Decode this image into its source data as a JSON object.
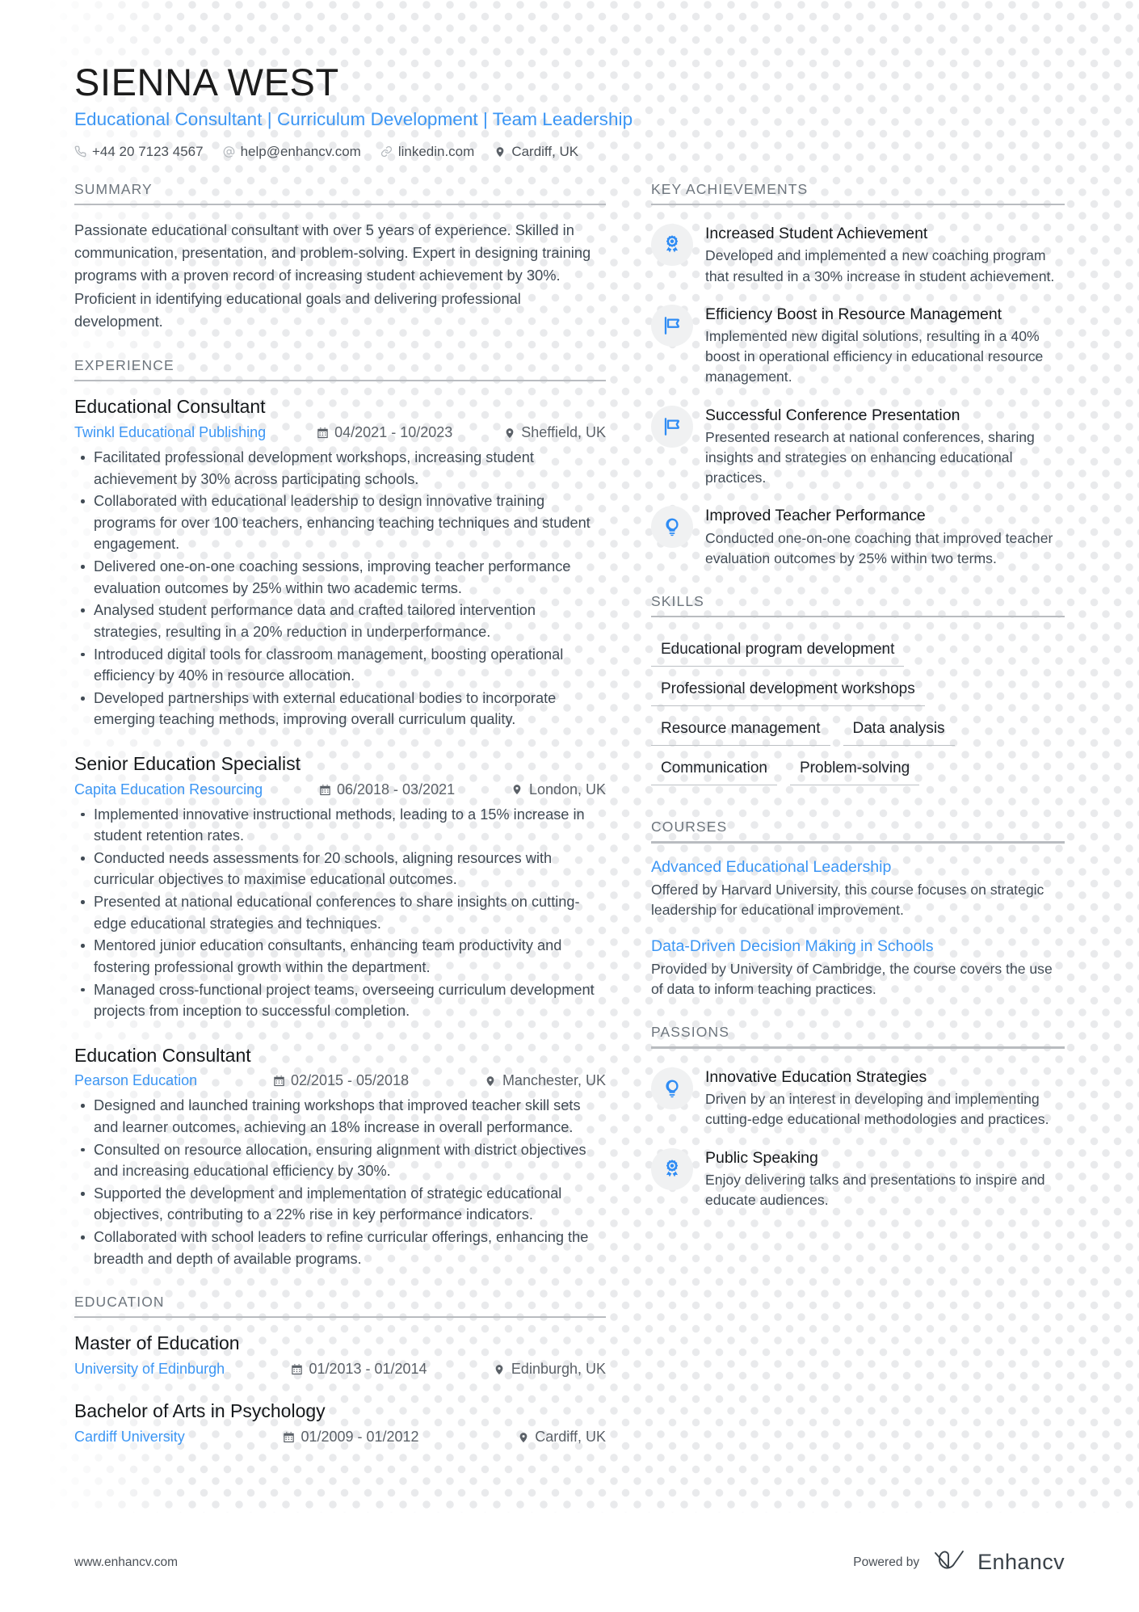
{
  "header": {
    "name": "SIENNA WEST",
    "headline": "Educational Consultant | Curriculum Development | Team Leadership",
    "contacts": [
      {
        "icon": "phone-icon",
        "value": "+44 20 7123 4567"
      },
      {
        "icon": "email-icon",
        "value": "help@enhancv.com"
      },
      {
        "icon": "link-icon",
        "value": "linkedin.com"
      },
      {
        "icon": "location-pin-icon",
        "value": "Cardiff, UK"
      }
    ]
  },
  "summary": {
    "title": "SUMMARY",
    "text": "Passionate educational consultant with over 5 years of experience. Skilled in communication, presentation, and problem-solving. Expert in designing training programs with a proven record of increasing student achievement by 30%. Proficient in identifying educational goals and delivering professional development."
  },
  "experience": {
    "title": "EXPERIENCE",
    "entries": [
      {
        "role": "Educational Consultant",
        "company": "Twinkl Educational Publishing",
        "dates": "04/2021 - 10/2023",
        "location": "Sheffield, UK",
        "bullets": [
          "Facilitated professional development workshops, increasing student achievement by 30% across participating schools.",
          "Collaborated with educational leadership to design innovative training programs for over 100 teachers, enhancing teaching techniques and student engagement.",
          "Delivered one-on-one coaching sessions, improving teacher performance evaluation outcomes by 25% within two academic terms.",
          "Analysed student performance data and crafted tailored intervention strategies, resulting in a 20% reduction in underperformance.",
          "Introduced digital tools for classroom management, boosting operational efficiency by 40% in resource allocation.",
          "Developed partnerships with external educational bodies to incorporate emerging teaching methods, improving overall curriculum quality."
        ]
      },
      {
        "role": "Senior Education Specialist",
        "company": "Capita Education Resourcing",
        "dates": "06/2018 - 03/2021",
        "location": "London, UK",
        "bullets": [
          "Implemented innovative instructional methods, leading to a 15% increase in student retention rates.",
          "Conducted needs assessments for 20 schools, aligning resources with curricular objectives to maximise educational outcomes.",
          "Presented at national educational conferences to share insights on cutting-edge educational strategies and techniques.",
          "Mentored junior education consultants, enhancing team productivity and fostering professional growth within the department.",
          "Managed cross-functional project teams, overseeing curriculum development projects from inception to successful completion."
        ]
      },
      {
        "role": "Education Consultant",
        "company": "Pearson Education",
        "dates": "02/2015 - 05/2018",
        "location": "Manchester, UK",
        "bullets": [
          "Designed and launched training workshops that improved teacher skill sets and learner outcomes, achieving an 18% increase in overall performance.",
          "Consulted on resource allocation, ensuring alignment with district objectives and increasing educational efficiency by 30%.",
          "Supported the development and implementation of strategic educational objectives, contributing to a 22% rise in key performance indicators.",
          "Collaborated with school leaders to refine curricular offerings, enhancing the breadth and depth of available programs."
        ]
      }
    ]
  },
  "education": {
    "title": "EDUCATION",
    "entries": [
      {
        "degree": "Master of Education",
        "school": "University of Edinburgh",
        "dates": "01/2013 - 01/2014",
        "location": "Edinburgh, UK"
      },
      {
        "degree": "Bachelor of Arts in Psychology",
        "school": "Cardiff University",
        "dates": "01/2009 - 01/2012",
        "location": "Cardiff, UK"
      }
    ]
  },
  "key_achievements": {
    "title": "KEY ACHIEVEMENTS",
    "items": [
      {
        "icon": "award-ribbon-icon",
        "title": "Increased Student Achievement",
        "description": "Developed and implemented a new coaching program that resulted in a 30% increase in student achievement."
      },
      {
        "icon": "flag-icon",
        "title": "Efficiency Boost in Resource Management",
        "description": "Implemented new digital solutions, resulting in a 40% boost in operational efficiency in educational resource management."
      },
      {
        "icon": "flag-icon",
        "title": "Successful Conference Presentation",
        "description": "Presented research at national conferences, sharing insights and strategies on enhancing educational practices."
      },
      {
        "icon": "lightbulb-icon",
        "title": "Improved Teacher Performance",
        "description": "Conducted one-on-one coaching that improved teacher evaluation outcomes by 25% within two terms."
      }
    ]
  },
  "skills": {
    "title": "SKILLS",
    "items": [
      "Educational program development",
      "Professional development workshops",
      "Resource management",
      "Data analysis",
      "Communication",
      "Problem-solving"
    ]
  },
  "courses": {
    "title": "COURSES",
    "items": [
      {
        "name": "Advanced Educational Leadership",
        "description": "Offered by Harvard University, this course focuses on strategic leadership for educational improvement."
      },
      {
        "name": "Data-Driven Decision Making in Schools",
        "description": "Provided by University of Cambridge, the course covers the use of data to inform teaching practices."
      }
    ]
  },
  "passions": {
    "title": "PASSIONS",
    "items": [
      {
        "icon": "lightbulb-icon",
        "title": "Innovative Education Strategies",
        "description": "Driven by an interest in developing and implementing cutting-edge educational methodologies and practices."
      },
      {
        "icon": "award-ribbon-icon",
        "title": "Public Speaking",
        "description": "Enjoy delivering talks and presentations to inspire and educate audiences."
      }
    ]
  },
  "footer": {
    "url": "www.enhancv.com",
    "powered_by": "Powered by",
    "brand": "Enhancv"
  },
  "colors": {
    "accent": "#3c96f4",
    "text": "#414b55",
    "heading": "#15181b",
    "muted": "#6d757d",
    "rule": "#b9bcc0",
    "dot": "#e9eaec",
    "icon_bg": "#f0f1f2"
  }
}
